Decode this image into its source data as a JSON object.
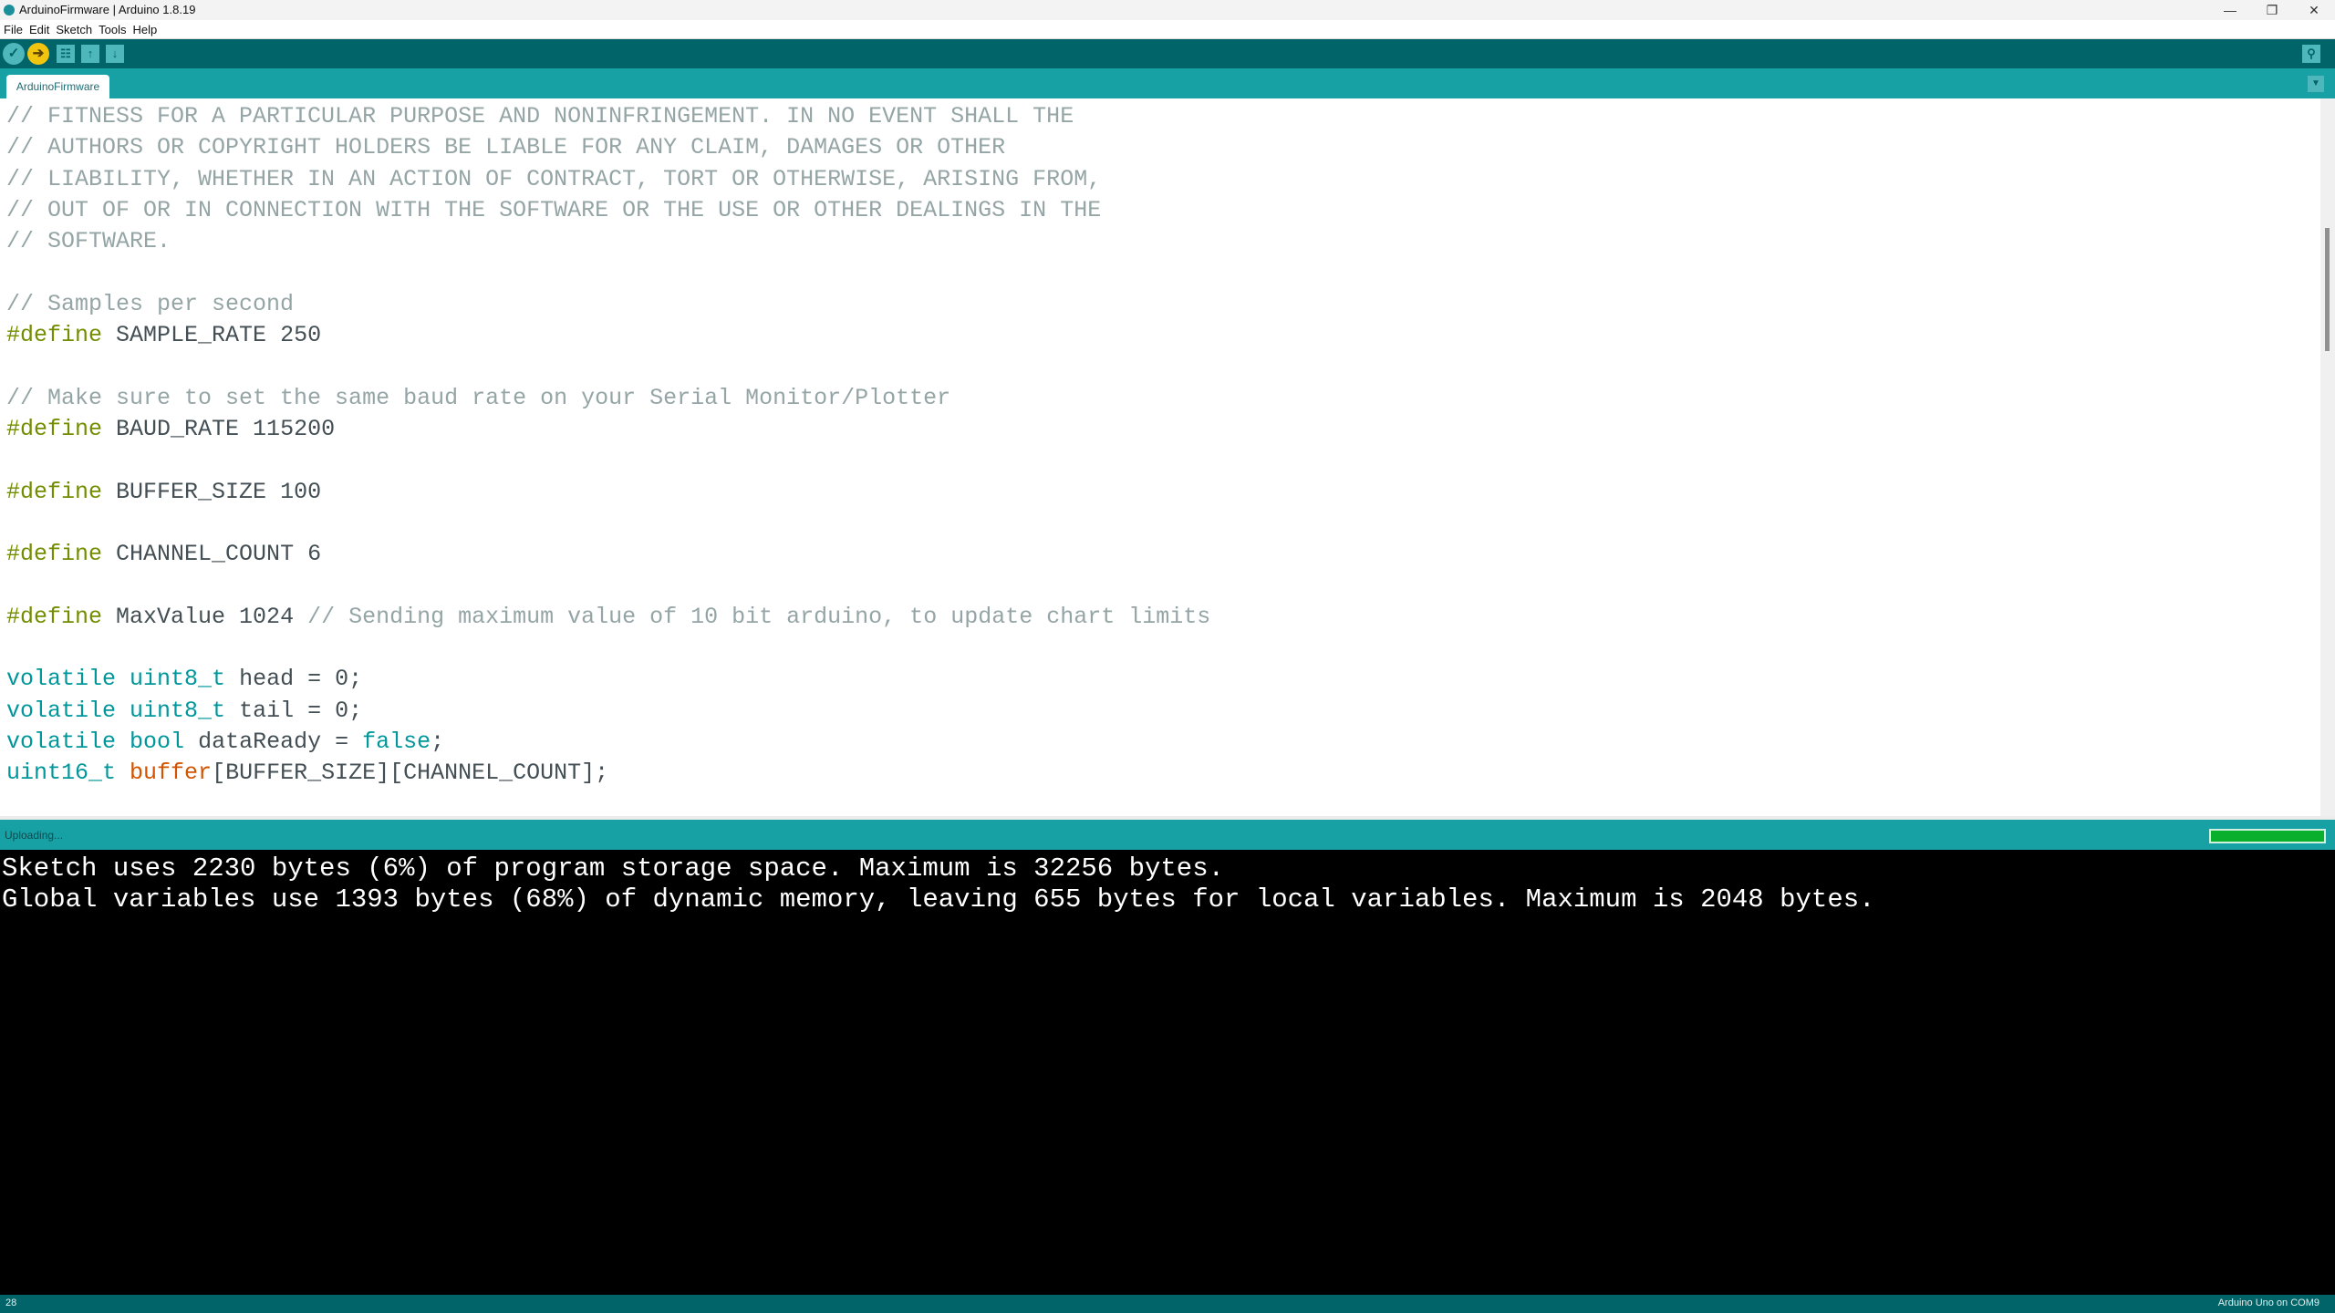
{
  "window": {
    "title": "ArduinoFirmware | Arduino 1.8.19",
    "controls": {
      "minimize": "—",
      "restore": "❐",
      "close": "✕"
    }
  },
  "menu": [
    "File",
    "Edit",
    "Sketch",
    "Tools",
    "Help"
  ],
  "toolbar": {
    "verify_icon": "✓",
    "upload_icon": "➔",
    "new_icon": "☷",
    "open_icon": "↑",
    "save_icon": "↓",
    "serial_monitor_icon": "⚲"
  },
  "tabs": [
    {
      "label": "ArduinoFirmware",
      "active": true
    }
  ],
  "tab_menu_icon": "▼",
  "editor": {
    "lines": [
      [
        {
          "t": "// FITNESS FOR A PARTICULAR PURPOSE AND NONINFRINGEMENT. IN NO EVENT SHALL THE",
          "c": "comment"
        }
      ],
      [
        {
          "t": "// AUTHORS OR COPYRIGHT HOLDERS BE LIABLE FOR ANY CLAIM, DAMAGES OR OTHER",
          "c": "comment"
        }
      ],
      [
        {
          "t": "// LIABILITY, WHETHER IN AN ACTION OF CONTRACT, TORT OR OTHERWISE, ARISING FROM,",
          "c": "comment"
        }
      ],
      [
        {
          "t": "// OUT OF OR IN CONNECTION WITH THE SOFTWARE OR THE USE OR OTHER DEALINGS IN THE",
          "c": "comment"
        }
      ],
      [
        {
          "t": "// SOFTWARE.",
          "c": "comment"
        }
      ],
      [],
      [
        {
          "t": "// Samples per second",
          "c": "comment"
        }
      ],
      [
        {
          "t": "#define",
          "c": "pre"
        },
        {
          "t": " SAMPLE_RATE 250",
          "c": "norm"
        }
      ],
      [],
      [
        {
          "t": "// Make sure to set the same baud rate on your Serial Monitor/Plotter",
          "c": "comment"
        }
      ],
      [
        {
          "t": "#define",
          "c": "pre"
        },
        {
          "t": " BAUD_RATE 115200",
          "c": "norm"
        }
      ],
      [],
      [
        {
          "t": "#define",
          "c": "pre"
        },
        {
          "t": " BUFFER_SIZE 100",
          "c": "norm"
        }
      ],
      [],
      [
        {
          "t": "#define",
          "c": "pre"
        },
        {
          "t": " CHANNEL_COUNT 6",
          "c": "norm"
        }
      ],
      [],
      [
        {
          "t": "#define",
          "c": "pre"
        },
        {
          "t": " MaxValue 1024 ",
          "c": "norm"
        },
        {
          "t": "// Sending maximum value of 10 bit arduino, to update chart limits",
          "c": "comment"
        }
      ],
      [],
      [
        {
          "t": "volatile",
          "c": "type"
        },
        {
          "t": " ",
          "c": "norm"
        },
        {
          "t": "uint8_t",
          "c": "type"
        },
        {
          "t": " head = 0;",
          "c": "norm"
        }
      ],
      [
        {
          "t": "volatile",
          "c": "type"
        },
        {
          "t": " ",
          "c": "norm"
        },
        {
          "t": "uint8_t",
          "c": "type"
        },
        {
          "t": " tail = 0;",
          "c": "norm"
        }
      ],
      [
        {
          "t": "volatile",
          "c": "type"
        },
        {
          "t": " ",
          "c": "norm"
        },
        {
          "t": "bool",
          "c": "type"
        },
        {
          "t": " dataReady = ",
          "c": "norm"
        },
        {
          "t": "false",
          "c": "type"
        },
        {
          "t": ";",
          "c": "norm"
        }
      ],
      [
        {
          "t": "uint16_t",
          "c": "type"
        },
        {
          "t": " ",
          "c": "norm"
        },
        {
          "t": "buffer",
          "c": "func"
        },
        {
          "t": "[BUFFER_SIZE][CHANNEL_COUNT];",
          "c": "norm"
        }
      ]
    ],
    "scroll_position_fraction": 0.18
  },
  "status": {
    "message": "Uploading...",
    "progress_percent": 100
  },
  "console": {
    "lines": [
      "Sketch uses 2230 bytes (6%) of program storage space. Maximum is 32256 bytes.",
      "Global variables use 1393 bytes (68%) of dynamic memory, leaving 655 bytes for local variables. Maximum is 2048 bytes."
    ]
  },
  "footer": {
    "line_number": "28",
    "board": "Arduino Uno on COM9"
  },
  "colors": {
    "toolbar": "#006468",
    "tabbar": "#17a1a5",
    "upload_button": "#f1c40f",
    "verify_button": "#4db7bb",
    "progress": "#0ab02c",
    "comment": "#95a5a6",
    "preprocessor": "#728e00",
    "keyword_type": "#00979c",
    "function": "#d35400"
  }
}
